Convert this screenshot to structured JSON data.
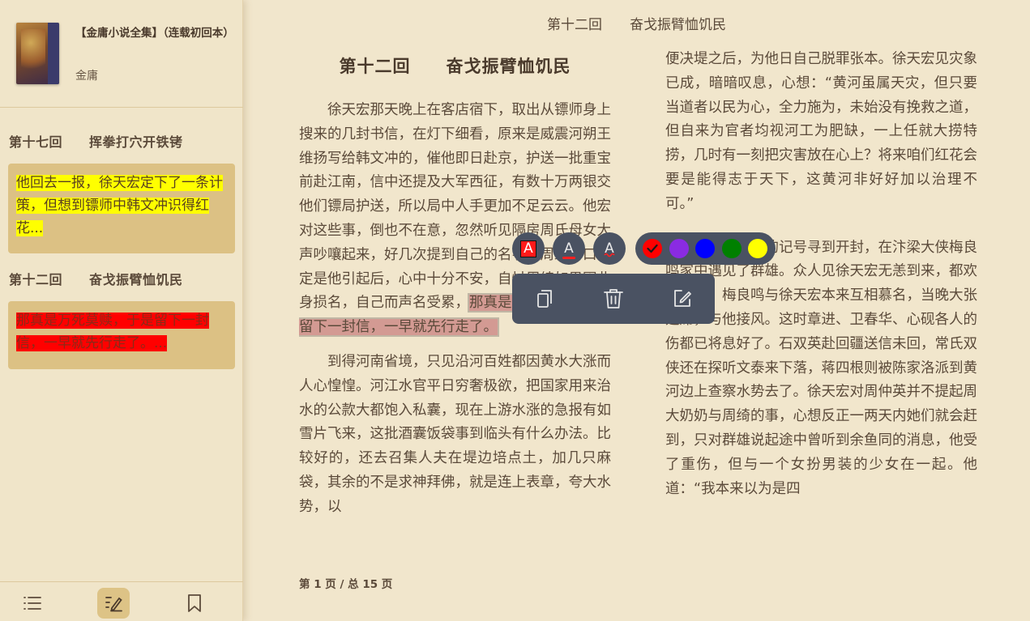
{
  "book": {
    "title": "【金庸小说全集】（连载初回本）",
    "author": "金庸"
  },
  "notes": [
    {
      "chapter": "第十七回　　挥拳打穴开铁铐",
      "text": "他回去一报，徐天宏定下了一条计策，但想到镖师中韩文冲识得红花...",
      "color": "#ffff00"
    },
    {
      "chapter": "第十二回　　奋戈振臂恤饥民",
      "text": "那真是万死莫赎，于是留下一封信，一早就先行走了。...",
      "color": "#ff0000"
    }
  ],
  "sidebar_footer": {
    "icons": [
      "list-icon",
      "notes-icon",
      "bookmark-icon"
    ],
    "active": "notes-icon"
  },
  "reader": {
    "header_title": "第十二回　　奋戈振臂恤饥民",
    "chapter_heading": "第十二回　　奋戈振臂恤饥民",
    "left_para1_before": "徐天宏那天晚上在客店宿下，取出从镖师身上搜来的几封书信，在灯下细看，原来是威震河朔王维扬写给韩文冲的，催他即日赴京，护送一批重宝前赴江南，信中还提及大军西征，有数十万两银交他们镖局护送，所以局中人手更加不足云云。他宏对这些事，倒也不在意，忽然听见隔房周氏母女大声吵嚷起来，好几次提到自己的名字，周绮一口咬定是他引起后，心中十分不安，自忖周绮如果因此身损名，自己而声名受累，",
    "left_para1_highlight": "那真是万死莫赎，于是留下一封信，一早就先行走了。",
    "left_para2": "到得河南省境，只见沿河百姓都因黄水大涨而人心惶惶。河江水官平日穷奢极欲，把国家用来治水的公款大都饱入私囊，现在上游水涨的急报有如雪片飞来，这批酒囊饭袋事到临头有什么办法。比较好的，还去召集人夫在堤边培点土，加几只麻袋，其余的不是求神拜佛，就是连上表章，夸大水势，以",
    "right_para1": "便决堤之后，为他日自己脱罪张本。徐天宏见灾象已成，暗暗叹息，心想：“黄河虽属天灾，但只要当道者以民为心，全力施为，未始没有挽救之道，但自来为官者均视河工为肥缺，一上任就大捞特捞，几时有一刻把灾害放在心上？将来咱们红花会要是能得志于天下，这黄河非好好加以治理不可。”",
    "right_para2": "依着红花会的记号寻到开封，在汴梁大侠梅良鸣家中遇见了群雄。众人见徐天宏无恙到来，都欢忭莫名。梅良鸣与徐天宏本来互相慕名，当晚大张筵席，与他接风。这时章进、卫春华、心砚各人的伤都已将息好了。石双英赴回疆送信未回，常氏双侠还在探听文泰来下落，蒋四根则被陈家洛派到黄河边上查察水势去了。徐天宏对周仲英并不提起周大奶奶与周绮的事，心想反正一两天内她们就会赶到，只对群雄说起途中曾听到余鱼同的消息，他受了重伤，但与一个女扮男装的少女在一起。他道：“我本来以为是四",
    "page_indicator": "第 1 页 / 总 15 页"
  },
  "toolbar": {
    "format_buttons": [
      {
        "letter": "A",
        "style": "highlight"
      },
      {
        "letter": "A",
        "style": "underline"
      },
      {
        "letter": "A",
        "style": "squiggle"
      }
    ],
    "colors": [
      "#ff0000",
      "#8a2be2",
      "#0000ff",
      "#008000",
      "#ffff00"
    ],
    "selected_color": "#ff0000",
    "actions": [
      "copy-icon",
      "delete-icon",
      "edit-icon"
    ]
  }
}
